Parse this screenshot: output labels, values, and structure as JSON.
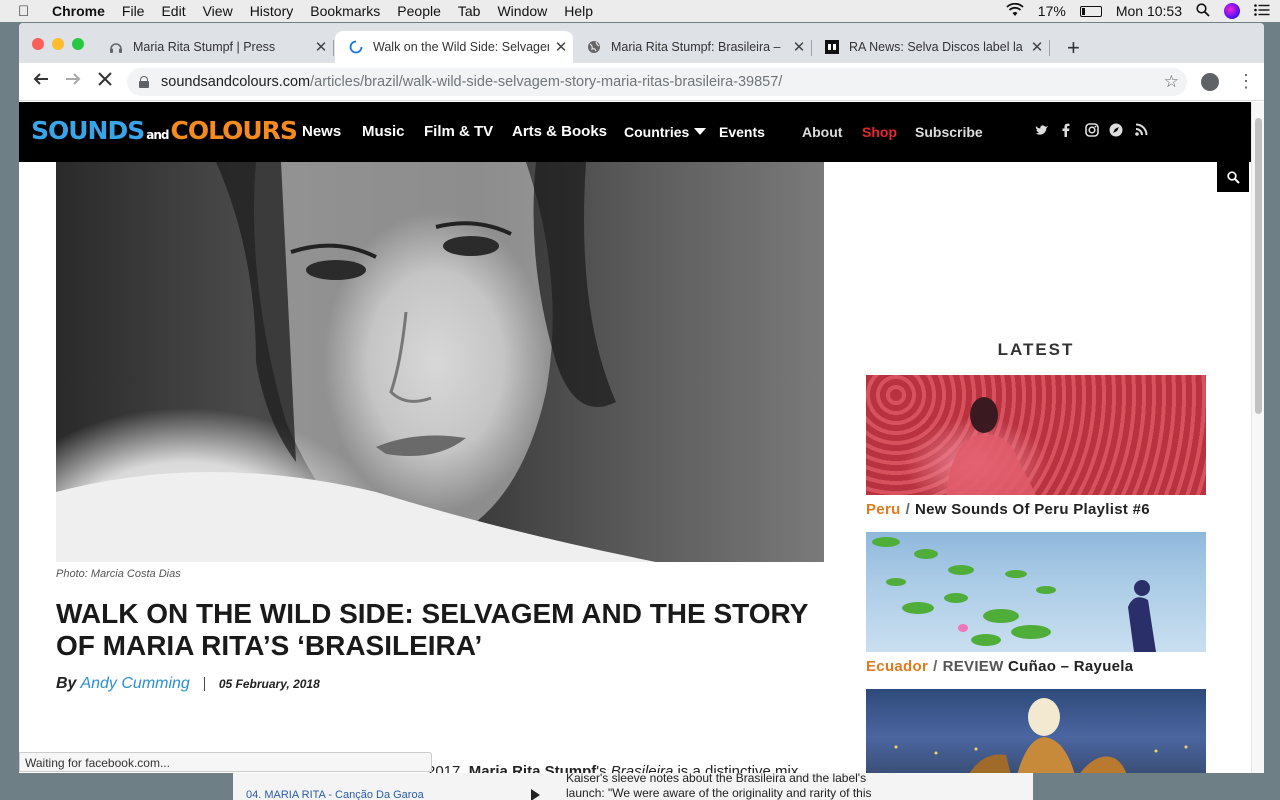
{
  "menubar": {
    "app": "Chrome",
    "items": [
      "File",
      "Edit",
      "View",
      "History",
      "Bookmarks",
      "People",
      "Tab",
      "Window",
      "Help"
    ],
    "battery": "17%",
    "battery_level": 0.17,
    "clock": "Mon 10:53"
  },
  "tabs": [
    {
      "title": "Maria Rita Stumpf | Press",
      "icon": "headphones-icon",
      "active": false
    },
    {
      "title": "Walk on the Wild Side: Selvagem",
      "icon": "loading-spinner-icon",
      "active": true
    },
    {
      "title": "Maria Rita Stumpf: Brasileira – ",
      "icon": "globe-icon",
      "active": false
    },
    {
      "title": "RA News: Selva Discos label la",
      "icon": "ra-logo-icon",
      "active": false
    }
  ],
  "toolbar": {
    "url_host": "soundsandcolours.com",
    "url_path": "/articles/brazil/walk-wild-side-selvagem-story-maria-ritas-brasileira-39857/"
  },
  "site": {
    "logo_sounds": "SOUNDS",
    "logo_and": "and",
    "logo_colours": "COLOURS",
    "nav": [
      "News",
      "Music",
      "Film & TV",
      "Arts & Books",
      "Countries",
      "Events"
    ],
    "nav_secondary": [
      "About",
      "Shop",
      "Subscribe"
    ],
    "social": [
      "twitter-icon",
      "facebook-icon",
      "instagram-icon",
      "compass-icon",
      "rss-icon"
    ],
    "colors": {
      "blue": "#3aa4e8",
      "orange": "#f58a1f",
      "shop_red": "#e8262d"
    }
  },
  "article": {
    "caption": "Photo: Marcia Costa Dias",
    "headline": "WALK ON THE WILD SIDE: SELVAGEM AND THE STORY OF MARIA RITA’S ‘BRASILEIRA’",
    "by": "By",
    "author": "Andy Cumming",
    "date": "05 February, 2018",
    "body_year": "2017,",
    "body_name": "Maria Rita Stumpf",
    "body_mid": "'s ",
    "body_album": "Brasileira",
    "body_tail": " is a distinctive mix"
  },
  "sidebar": {
    "heading": "LATEST",
    "cards": [
      {
        "category": "Peru",
        "kind": "",
        "title": "New Sounds Of Peru Playlist #6"
      },
      {
        "category": "Ecuador",
        "kind": "REVIEW",
        "title": "Cuñao – Rayuela"
      },
      {
        "category": "",
        "kind": "",
        "title": ""
      }
    ]
  },
  "status": "Waiting for facebook.com...",
  "background_page": {
    "track": "04. MARIA RITA - Canção Da Garoa",
    "line1": "Kaiser's sleeve notes about the Brasileira and the label's",
    "line2": "launch: \"We were aware of the originality and rarity of this"
  }
}
